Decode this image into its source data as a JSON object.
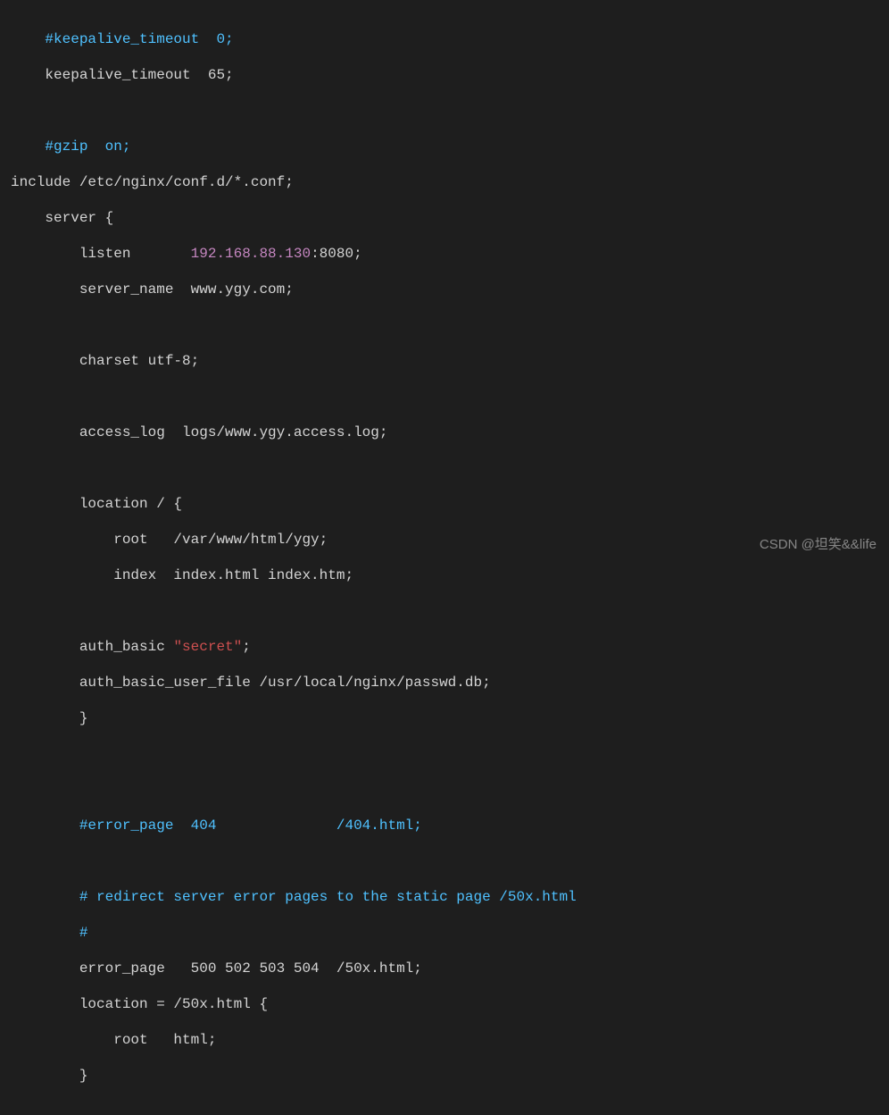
{
  "code": {
    "l1": "    #keepalive_timeout  0;",
    "l2": "    keepalive_timeout  65;",
    "l3": "",
    "l4": "    #gzip  on;",
    "l5": "include /etc/nginx/conf.d/*.conf;",
    "l6": "    server {",
    "l7a": "        listen       ",
    "l7b": "192.168.88.130",
    "l7c": ":8080;",
    "l8": "        server_name  www.ygy.com;",
    "l9": "",
    "l10": "        charset utf-8;",
    "l11": "",
    "l12": "        access_log  logs/www.ygy.access.log;",
    "l13": "",
    "l14": "        location / {",
    "l15": "            root   /var/www/html/ygy;",
    "l16": "            index  index.html index.htm;",
    "l17": "",
    "l18a": "        auth_basic ",
    "l18b": "\"secret\"",
    "l18c": ";",
    "l19": "        auth_basic_user_file /usr/local/nginx/passwd.db;",
    "l20": "        }",
    "l21": "",
    "l22": "",
    "l23": "        #error_page  404              /404.html;",
    "l24": "",
    "l25": "        # redirect server error pages to the static page /50x.html",
    "l26": "        #",
    "l27": "        error_page   500 502 503 504  /50x.html;",
    "l28": "        location = /50x.html {",
    "l29": "            root   html;",
    "l30": "        }"
  },
  "watermark": "CSDN @坦笑&&life"
}
